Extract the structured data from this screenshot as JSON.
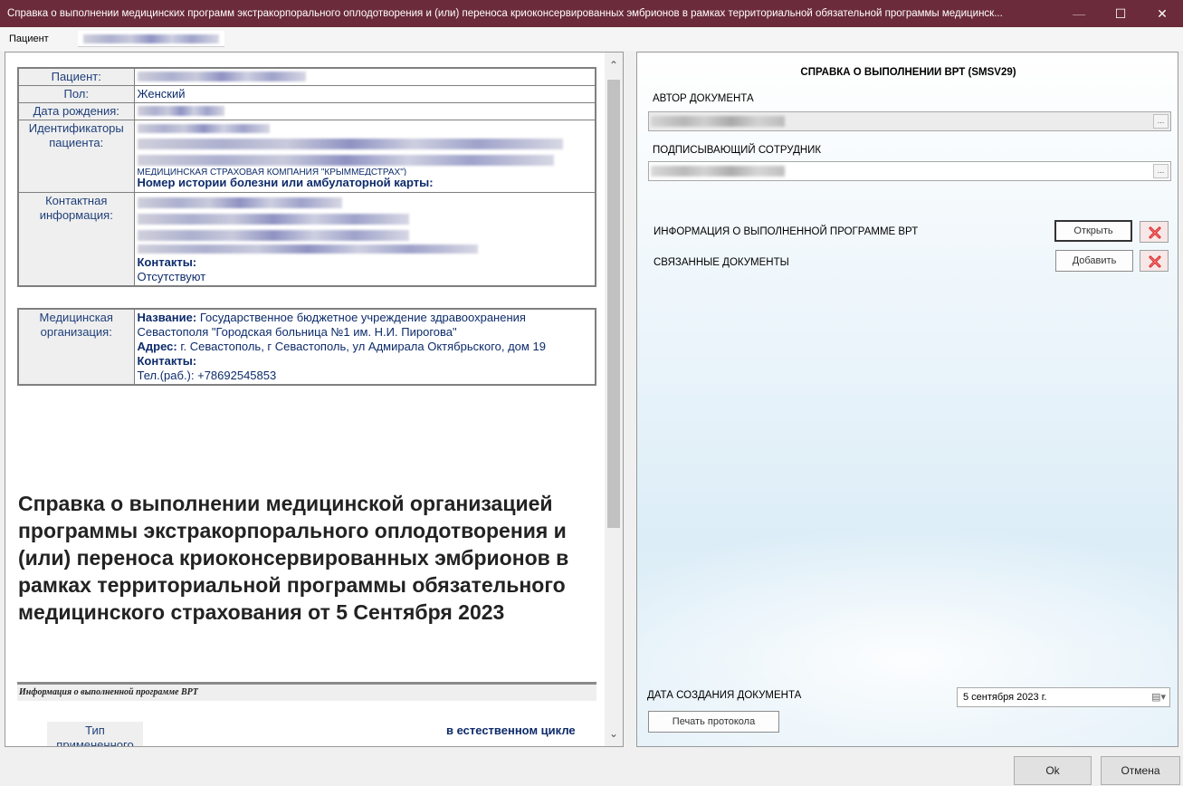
{
  "window": {
    "title": "Справка о выполнении медицинских программ экстракорпорального оплодотворения и (или) переноса криоконсервированных эмбрионов в рамках территориальной обязательной программы медицинск...",
    "min_icon": "minimize-icon",
    "max_icon": "maximize-icon",
    "close_icon": "close-icon"
  },
  "patient_tab": {
    "label": "Пациент"
  },
  "document": {
    "patient_label": "Пациент:",
    "sex_label": "Пол:",
    "sex_value": "Женский",
    "dob_label": "Дата рождения:",
    "ids_label": "Идентификаторы пациента:",
    "ids_partial": "МЕДИЦИНСКАЯ СТРАХОВАЯ КОМПАНИЯ \"КРЫММЕДСТРАХ\")",
    "history_label": "Номер истории болезни или амбулаторной карты:",
    "contact_label": "Контактная информация:",
    "contacts_label": "Контакты:",
    "contacts_value": "Отсутствуют",
    "org_label": "Медицинская организация:",
    "org_name_label": "Название:",
    "org_name_value": "Государственное бюджетное учреждение здравоохранения Севастополя \"Городская больница №1 им. Н.И. Пирогова\"",
    "org_address_label": "Адрес:",
    "org_address_value": "г. Севастополь, г Севастополь, ул Адмирала Октябрьского, дом 19",
    "org_contacts_label": "Контакты:",
    "org_phone": "Тел.(раб.): +78692545853",
    "title": "Справка о выполнении медицинской организацией программы экстракорпорального оплодотворения и (или) переноса криоконсервированных эмбрионов в рамках территориальной программы обязательного медицинского страхования от 5 Сентября 2023",
    "section_title": "Информация о выполненной программе ВРТ",
    "type_label": "Тип примененного",
    "type_value": "в естественном цикле"
  },
  "form": {
    "heading": "СПРАВКА О ВЫПОЛНЕНИИ ВРТ (SMSV29)",
    "author_label": "АВТОР ДОКУМЕНТА",
    "signer_label": "ПОДПИСЫВАЮЩИЙ СОТРУДНИК",
    "ellipsis": "...",
    "art_info_label": "ИНФОРМАЦИЯ О ВЫПОЛНЕННОЙ ПРОГРАММЕ ВРТ",
    "open_button": "Открыть",
    "related_label": "СВЯЗАННЫЕ ДОКУМЕНТЫ",
    "add_button": "Добавить",
    "date_label": "ДАТА СОЗДАНИЯ ДОКУМЕНТА",
    "date_value": "5 сентября 2023 г.",
    "print_button": "Печать протокола"
  },
  "footer": {
    "ok": "Ok",
    "cancel": "Отмена"
  }
}
